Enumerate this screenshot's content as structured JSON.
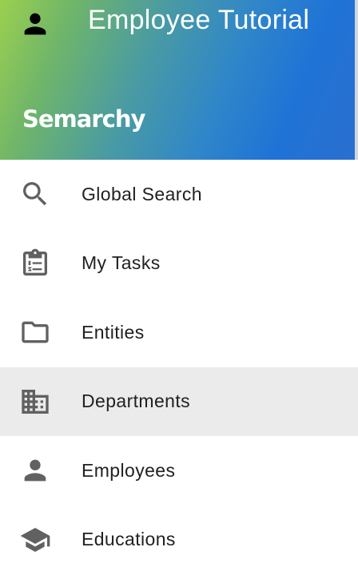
{
  "header": {
    "title": "Employee Tutorial",
    "brand": "Semarchy",
    "user_icon": "person-icon"
  },
  "menu": {
    "items": [
      {
        "label": "Global Search",
        "icon": "search-icon",
        "active": false
      },
      {
        "label": "My Tasks",
        "icon": "clipboard-tasks-icon",
        "active": false
      },
      {
        "label": "Entities",
        "icon": "folder-icon",
        "active": false
      },
      {
        "label": "Departments",
        "icon": "building-icon",
        "active": true
      },
      {
        "label": "Employees",
        "icon": "person-icon",
        "active": false
      },
      {
        "label": "Educations",
        "icon": "graduation-cap-icon",
        "active": false
      }
    ]
  },
  "colors": {
    "icon_gray": "#616161",
    "text": "#212121",
    "active_background": "#ebebeb",
    "gradient_start": "#9bd04f",
    "gradient_end": "#1f73d6"
  }
}
